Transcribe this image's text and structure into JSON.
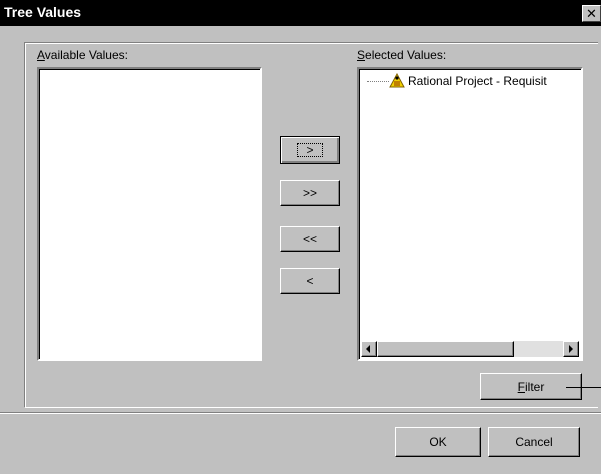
{
  "window": {
    "title": "Tree Values",
    "close_glyph": "✕"
  },
  "available": {
    "label": "Available Values:",
    "accelerator": "A",
    "items": []
  },
  "selected": {
    "label": "Selected Values:",
    "accelerator": "S",
    "items": [
      {
        "label": "Rational Project - Requisit",
        "icon": "project-folder-icon"
      }
    ]
  },
  "transfer_buttons": {
    "add": ">",
    "add_all": ">>",
    "remove_all": "<<",
    "remove": "<"
  },
  "filter_button": {
    "label": "Filter",
    "accelerator": "F"
  },
  "ok_button": {
    "label": "OK"
  },
  "cancel_button": {
    "label": "Cancel"
  },
  "colors": {
    "title_bar": "#000000",
    "dialog_face": "#c0c0c0",
    "list_background": "#ffffff",
    "icon_yellow": "#f0d000"
  }
}
